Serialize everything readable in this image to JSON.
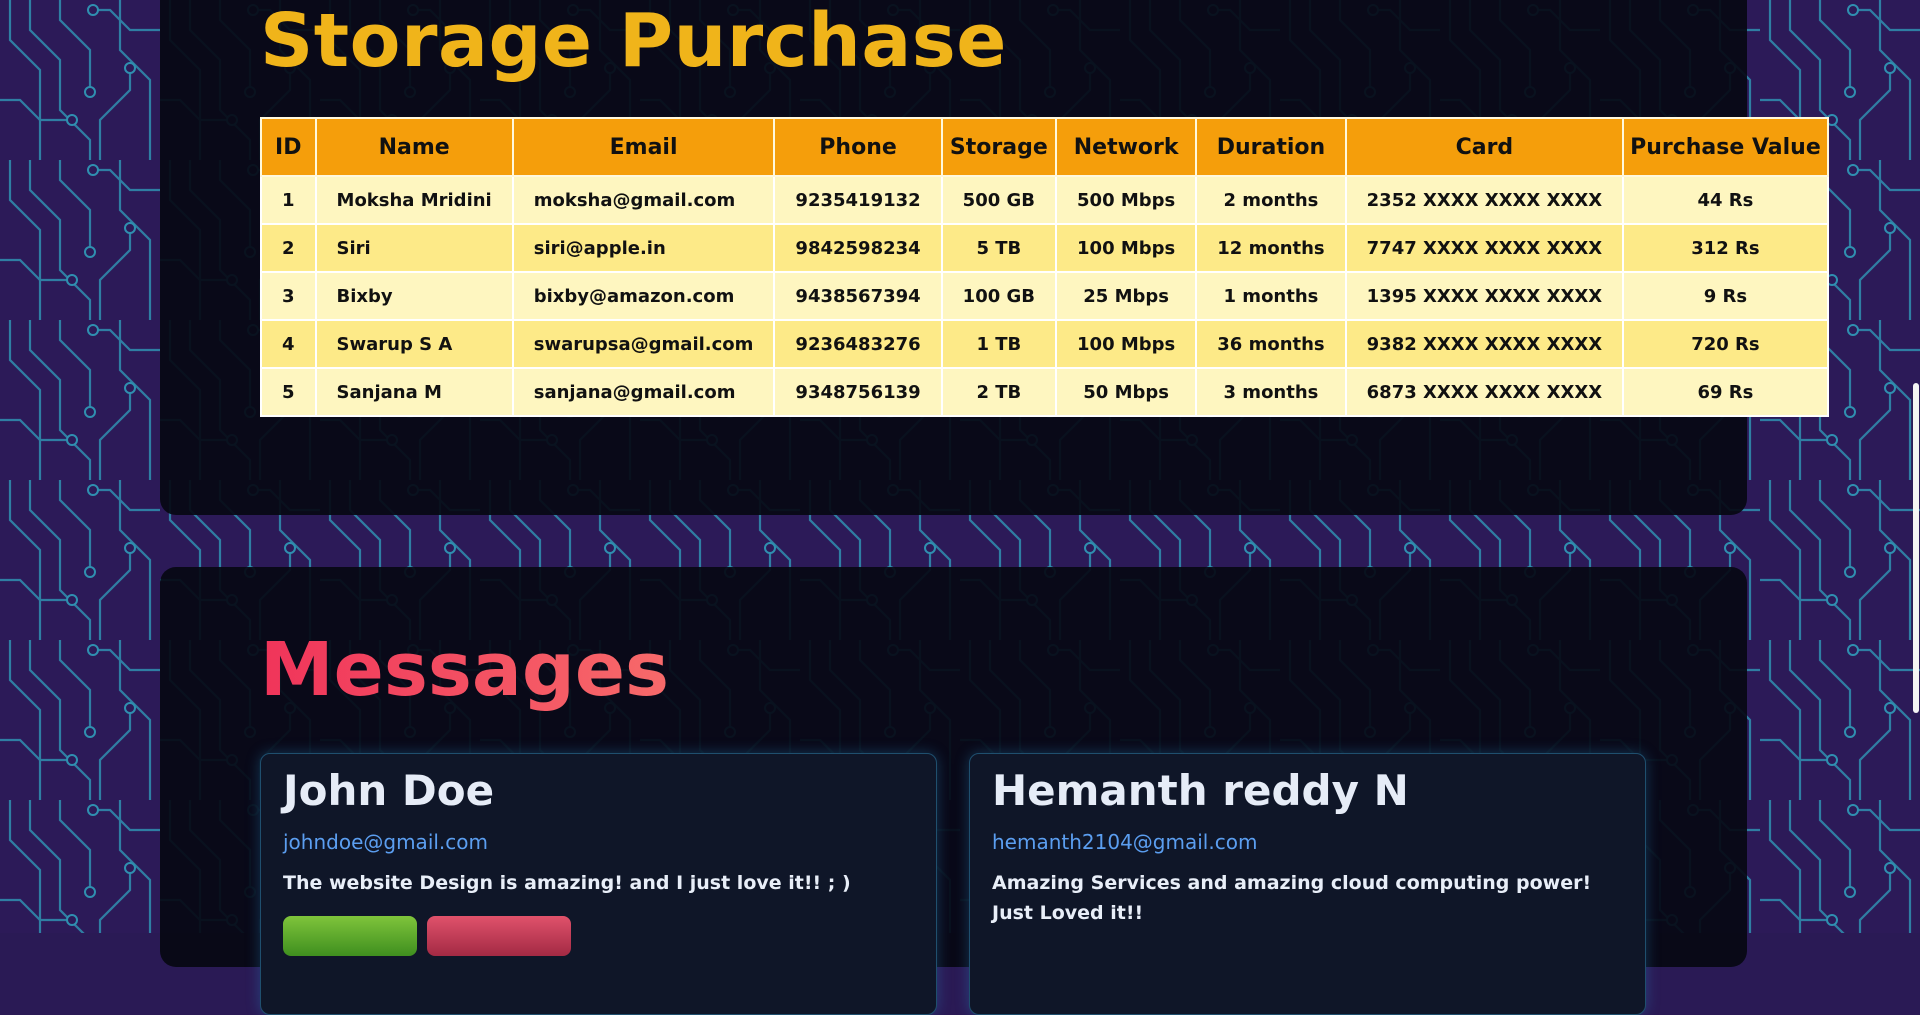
{
  "storage": {
    "title": "Storage Purchase",
    "columns": [
      "ID",
      "Name",
      "Email",
      "Phone",
      "Storage",
      "Network",
      "Duration",
      "Card",
      "Purchase Value"
    ],
    "rows": [
      {
        "id": "1",
        "name": "Moksha Mridini",
        "email": "moksha@gmail.com",
        "phone": "9235419132",
        "storage": "500 GB",
        "network": "500 Mbps",
        "duration": "2 months",
        "card": "2352 XXXX XXXX XXXX",
        "value": "44 Rs"
      },
      {
        "id": "2",
        "name": "Siri",
        "email": "siri@apple.in",
        "phone": "9842598234",
        "storage": "5 TB",
        "network": "100 Mbps",
        "duration": "12 months",
        "card": "7747 XXXX XXXX XXXX",
        "value": "312 Rs"
      },
      {
        "id": "3",
        "name": "Bixby",
        "email": "bixby@amazon.com",
        "phone": "9438567394",
        "storage": "100 GB",
        "network": "25 Mbps",
        "duration": "1 months",
        "card": "1395 XXXX XXXX XXXX",
        "value": "9 Rs"
      },
      {
        "id": "4",
        "name": "Swarup S A",
        "email": "swarupsa@gmail.com",
        "phone": "9236483276",
        "storage": "1 TB",
        "network": "100 Mbps",
        "duration": "36 months",
        "card": "9382 XXXX XXXX XXXX",
        "value": "720 Rs"
      },
      {
        "id": "5",
        "name": "Sanjana M",
        "email": "sanjana@gmail.com",
        "phone": "9348756139",
        "storage": "2 TB",
        "network": "50 Mbps",
        "duration": "3 months",
        "card": "6873 XXXX XXXX XXXX",
        "value": "69 Rs"
      }
    ]
  },
  "messages": {
    "title": "Messages",
    "cards": [
      {
        "name": "John Doe",
        "email": "johndoe@gmail.com",
        "message": "The website Design is amazing! and I just love it!! ; )"
      },
      {
        "name": "Hemanth reddy N",
        "email": "hemanth2104@gmail.com",
        "message": "Amazing Services and amazing cloud computing power! Just Loved it!!"
      }
    ]
  },
  "colors": {
    "background": "#2a1a55",
    "panel": "#06080f",
    "storage_title": "#f0b41a",
    "table_header": "#f59e0b",
    "row_light": "#fef6c0",
    "row_dark": "#fdea88",
    "messages_title": "#f0345a",
    "card_email": "#5b9ef0",
    "approve_button": "#5aa52c",
    "delete_button": "#c63a56"
  }
}
